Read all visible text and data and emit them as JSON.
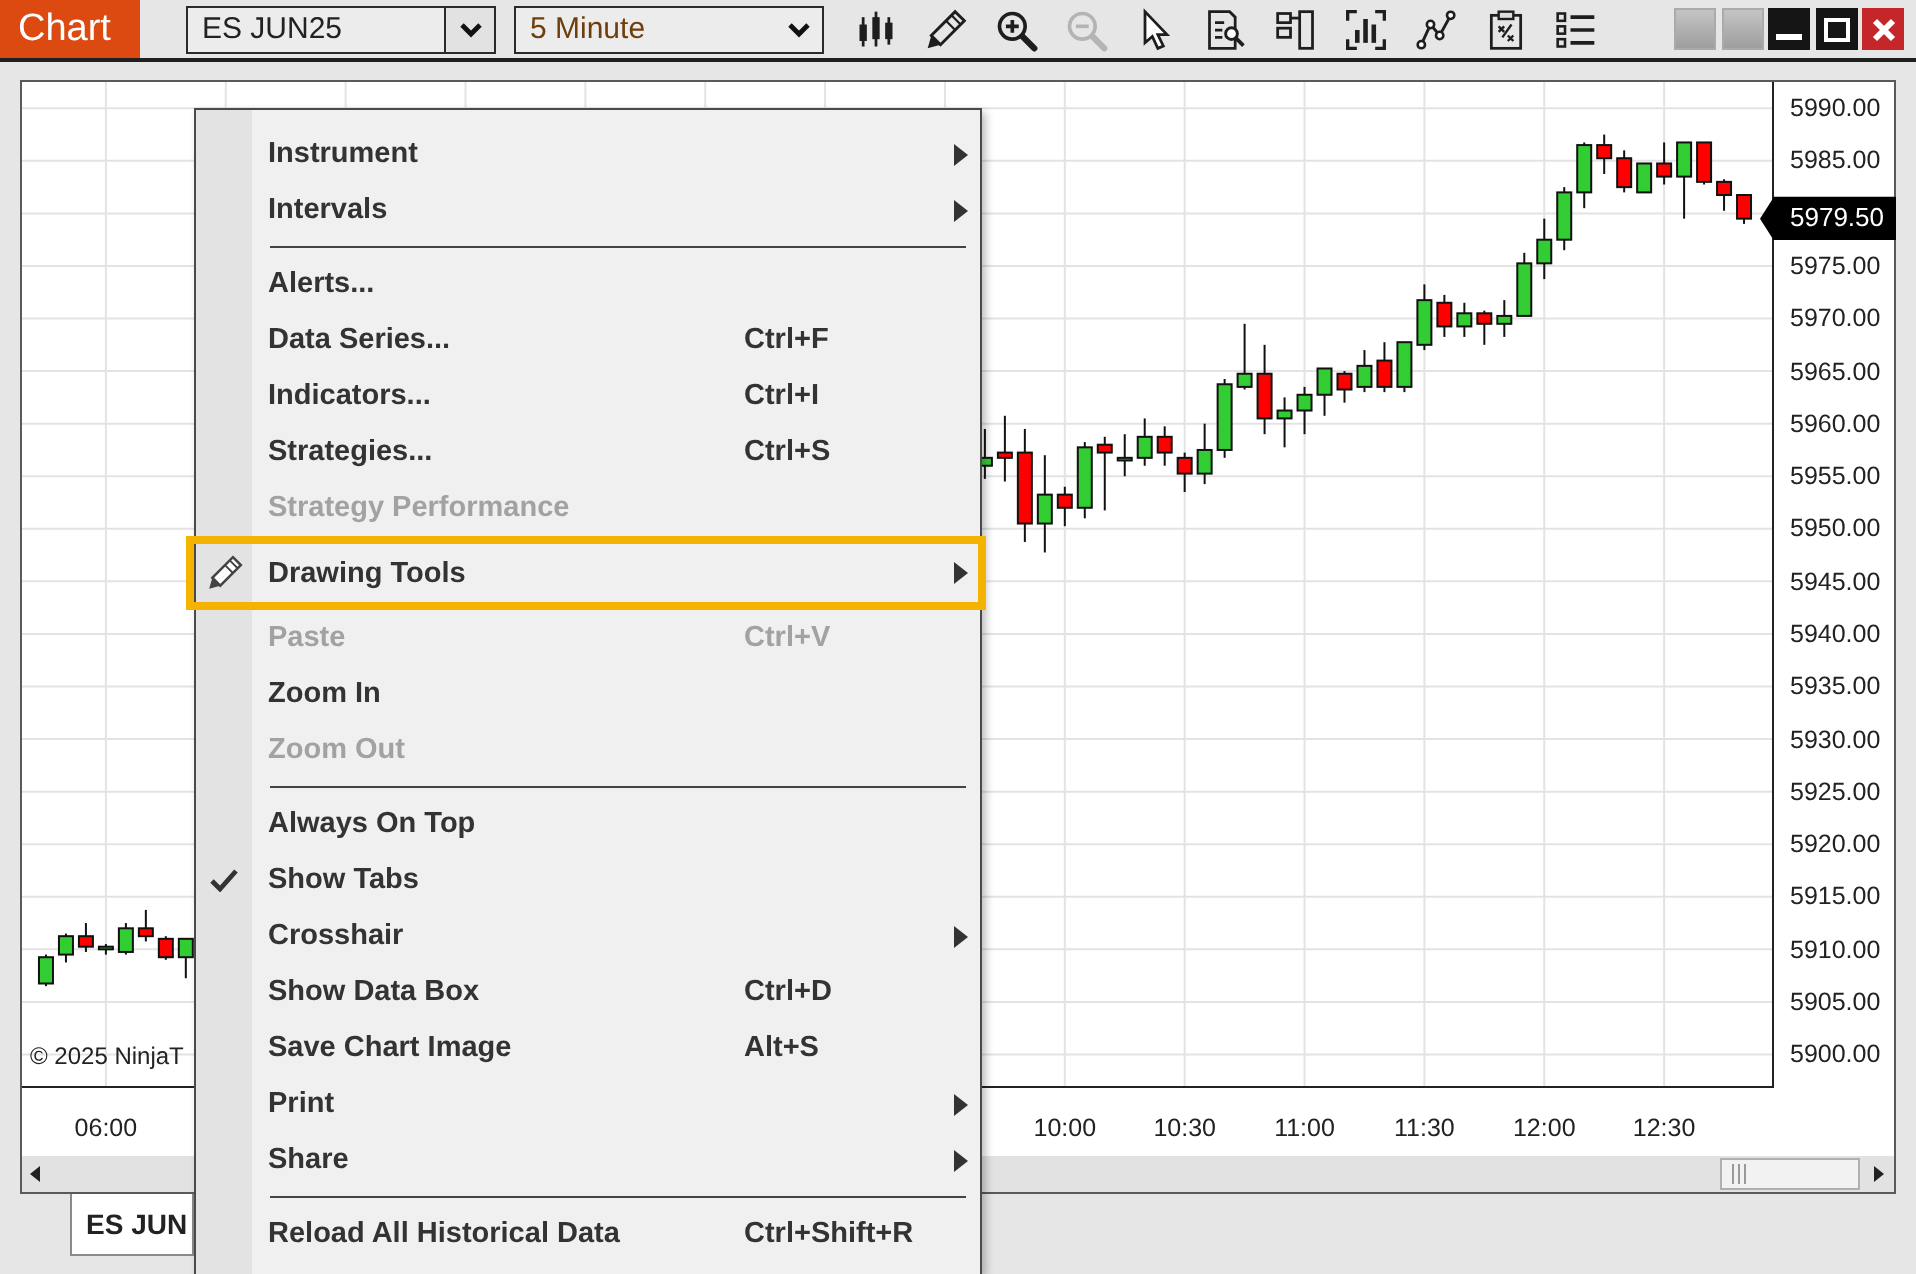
{
  "window": {
    "title": "Chart"
  },
  "toolbar": {
    "instrument": {
      "value": "ES JUN25"
    },
    "interval": {
      "value": "5 Minute"
    },
    "tools": [
      {
        "disabled": false
      },
      {
        "disabled": false
      },
      {
        "disabled": false
      },
      {
        "disabled": true
      },
      {
        "disabled": false
      },
      {
        "disabled": false
      },
      {
        "disabled": false
      },
      {
        "disabled": false
      },
      {
        "disabled": false
      },
      {
        "disabled": false
      },
      {
        "disabled": false
      }
    ]
  },
  "chart": {
    "chart_data": {
      "type": "candlestick",
      "grid": true,
      "x": [
        345,
        350,
        355,
        360,
        365,
        370,
        375,
        380,
        580,
        585,
        590,
        595,
        600,
        605,
        610,
        615,
        620,
        625,
        630,
        635,
        640,
        645,
        650,
        655,
        660,
        665,
        670,
        675,
        680,
        685,
        690,
        695,
        700,
        705,
        710,
        715,
        720,
        725,
        730,
        735,
        740,
        745,
        750,
        755,
        760,
        765,
        770
      ],
      "ohlc": [
        [
          5906.75,
          5909.5,
          5906.5,
          5909.25
        ],
        [
          5909.5,
          5911.5,
          5908.75,
          5911.25
        ],
        [
          5911.25,
          5912.5,
          5909.75,
          5910.25
        ],
        [
          5910,
          5910.5,
          5909.5,
          5910.25
        ],
        [
          5909.75,
          5912.5,
          5909.5,
          5912
        ],
        [
          5912,
          5913.75,
          5910.75,
          5911.25
        ],
        [
          5911,
          5911.25,
          5909,
          5909.25
        ],
        [
          5909.25,
          5911,
          5907.25,
          5911
        ],
        [
          5956,
          5959.5,
          5954.75,
          5956.75
        ],
        [
          5957.25,
          5960.75,
          5954.5,
          5956.75
        ],
        [
          5957.25,
          5959.5,
          5948.75,
          5950.5
        ],
        [
          5950.5,
          5957,
          5947.75,
          5953.25
        ],
        [
          5953.25,
          5954,
          5950.25,
          5952
        ],
        [
          5952,
          5958.25,
          5951,
          5957.75
        ],
        [
          5958,
          5958.75,
          5951.75,
          5957.25
        ],
        [
          5956.5,
          5959,
          5955,
          5956.75
        ],
        [
          5956.75,
          5960.5,
          5956,
          5958.75
        ],
        [
          5958.75,
          5959.75,
          5956,
          5957.25
        ],
        [
          5956.75,
          5957.25,
          5953.5,
          5955.25
        ],
        [
          5955.25,
          5960,
          5954.25,
          5957.5
        ],
        [
          5957.5,
          5964.25,
          5956.75,
          5963.75
        ],
        [
          5963.5,
          5969.5,
          5963.25,
          5964.75
        ],
        [
          5964.75,
          5967.5,
          5959,
          5960.5
        ],
        [
          5960.5,
          5962.5,
          5957.75,
          5961.25
        ],
        [
          5961.25,
          5963.5,
          5959,
          5962.75
        ],
        [
          5962.75,
          5965.25,
          5960.75,
          5965.25
        ],
        [
          5964.75,
          5965,
          5962,
          5963.25
        ],
        [
          5963.5,
          5967,
          5963,
          5965.5
        ],
        [
          5966,
          5967.75,
          5963,
          5963.5
        ],
        [
          5963.5,
          5967.75,
          5963,
          5967.75
        ],
        [
          5967.5,
          5973.25,
          5967,
          5971.75
        ],
        [
          5971.5,
          5972.25,
          5968.25,
          5969.25
        ],
        [
          5969.25,
          5971.5,
          5968.25,
          5970.5
        ],
        [
          5970.5,
          5970.75,
          5967.5,
          5969.5
        ],
        [
          5969.5,
          5971.75,
          5968.25,
          5970.25
        ],
        [
          5970.25,
          5976.25,
          5970.25,
          5975.25
        ],
        [
          5975.25,
          5979.5,
          5973.75,
          5977.5
        ],
        [
          5977.5,
          5982.5,
          5976.5,
          5982
        ],
        [
          5982,
          5986.75,
          5980.5,
          5986.5
        ],
        [
          5986.5,
          5987.5,
          5983.75,
          5985.25
        ],
        [
          5985.25,
          5986,
          5982,
          5982.5
        ],
        [
          5982,
          5984.75,
          5982,
          5984.75
        ],
        [
          5984.75,
          5986.75,
          5982.75,
          5983.5
        ],
        [
          5983.5,
          5986.75,
          5979.5,
          5986.75
        ],
        [
          5986.75,
          5986.75,
          5982.75,
          5983
        ],
        [
          5983,
          5983.25,
          5980.25,
          5981.75
        ],
        [
          5981.75,
          5981.75,
          5979,
          5979.5
        ]
      ],
      "xlim": [
        339,
        777
      ],
      "ylim": [
        5897,
        5992.5
      ],
      "xticks": [
        {
          "value": 360,
          "label": "06:00"
        },
        {
          "value": 600,
          "label": "10:00"
        },
        {
          "value": 630,
          "label": "10:30"
        },
        {
          "value": 660,
          "label": "11:00"
        },
        {
          "value": 690,
          "label": "11:30"
        },
        {
          "value": 720,
          "label": "12:00"
        },
        {
          "value": 750,
          "label": "12:30"
        }
      ],
      "yticks": [
        {
          "value": 5990,
          "label": "5990.00"
        },
        {
          "value": 5985,
          "label": "5985.00"
        },
        {
          "value": 5975,
          "label": "5975.00"
        },
        {
          "value": 5970,
          "label": "5970.00"
        },
        {
          "value": 5965,
          "label": "5965.00"
        },
        {
          "value": 5960,
          "label": "5960.00"
        },
        {
          "value": 5955,
          "label": "5955.00"
        },
        {
          "value": 5950,
          "label": "5950.00"
        },
        {
          "value": 5945,
          "label": "5945.00"
        },
        {
          "value": 5940,
          "label": "5940.00"
        },
        {
          "value": 5935,
          "label": "5935.00"
        },
        {
          "value": 5930,
          "label": "5930.00"
        },
        {
          "value": 5925,
          "label": "5925.00"
        },
        {
          "value": 5920,
          "label": "5920.00"
        },
        {
          "value": 5915,
          "label": "5915.00"
        },
        {
          "value": 5910,
          "label": "5910.00"
        },
        {
          "value": 5905,
          "label": "5905.00"
        },
        {
          "value": 5900,
          "label": "5900.00"
        }
      ]
    },
    "last_price": "5979.50",
    "copyright": "© 2025 NinjaT"
  },
  "tabs": [
    {
      "label": "ES JUN",
      "selected": true
    }
  ],
  "context_menu": {
    "items": [
      {
        "kind": "item",
        "label": "Instrument",
        "submenu": true,
        "disabled": false,
        "checked": false,
        "highlighted": false
      },
      {
        "kind": "item",
        "label": "Intervals",
        "submenu": true,
        "disabled": false,
        "checked": false,
        "highlighted": false
      },
      {
        "kind": "separator"
      },
      {
        "kind": "item",
        "label": "Alerts...",
        "submenu": false,
        "disabled": false,
        "checked": false,
        "highlighted": false
      },
      {
        "kind": "item",
        "label": "Data Series...",
        "shortcut": "Ctrl+F",
        "submenu": false,
        "disabled": false,
        "checked": false,
        "highlighted": false
      },
      {
        "kind": "item",
        "label": "Indicators...",
        "shortcut": "Ctrl+I",
        "submenu": false,
        "disabled": false,
        "checked": false,
        "highlighted": false
      },
      {
        "kind": "item",
        "label": "Strategies...",
        "shortcut": "Ctrl+S",
        "submenu": false,
        "disabled": false,
        "checked": false,
        "highlighted": false
      },
      {
        "kind": "item",
        "label": "Strategy Performance",
        "submenu": false,
        "disabled": true,
        "checked": false,
        "highlighted": false
      },
      {
        "kind": "tool",
        "label": "Drawing Tools",
        "submenu": true,
        "disabled": false,
        "checked": false,
        "highlighted": true
      },
      {
        "kind": "item",
        "label": "Paste",
        "shortcut": "Ctrl+V",
        "submenu": false,
        "disabled": true,
        "checked": false,
        "highlighted": false
      },
      {
        "kind": "item",
        "label": "Zoom In",
        "submenu": false,
        "disabled": false,
        "checked": false,
        "highlighted": false
      },
      {
        "kind": "item",
        "label": "Zoom Out",
        "submenu": false,
        "disabled": true,
        "checked": false,
        "highlighted": false
      },
      {
        "kind": "separator"
      },
      {
        "kind": "item",
        "label": "Always On Top",
        "submenu": false,
        "disabled": false,
        "checked": false,
        "highlighted": false
      },
      {
        "kind": "item",
        "label": "Show Tabs",
        "submenu": false,
        "disabled": false,
        "checked": true,
        "highlighted": false
      },
      {
        "kind": "item",
        "label": "Crosshair",
        "submenu": true,
        "disabled": false,
        "checked": false,
        "highlighted": false
      },
      {
        "kind": "item",
        "label": "Show Data Box",
        "shortcut": "Ctrl+D",
        "submenu": false,
        "disabled": false,
        "checked": false,
        "highlighted": false
      },
      {
        "kind": "item",
        "label": "Save Chart Image",
        "shortcut": "Alt+S",
        "submenu": false,
        "disabled": false,
        "checked": false,
        "highlighted": false
      },
      {
        "kind": "item",
        "label": "Print",
        "submenu": true,
        "disabled": false,
        "checked": false,
        "highlighted": false
      },
      {
        "kind": "item",
        "label": "Share",
        "submenu": true,
        "disabled": false,
        "checked": false,
        "highlighted": false
      },
      {
        "kind": "separator"
      },
      {
        "kind": "item",
        "label": "Reload All Historical Data",
        "shortcut": "Ctrl+Shift+R",
        "submenu": false,
        "disabled": false,
        "checked": false,
        "highlighted": false
      }
    ]
  }
}
